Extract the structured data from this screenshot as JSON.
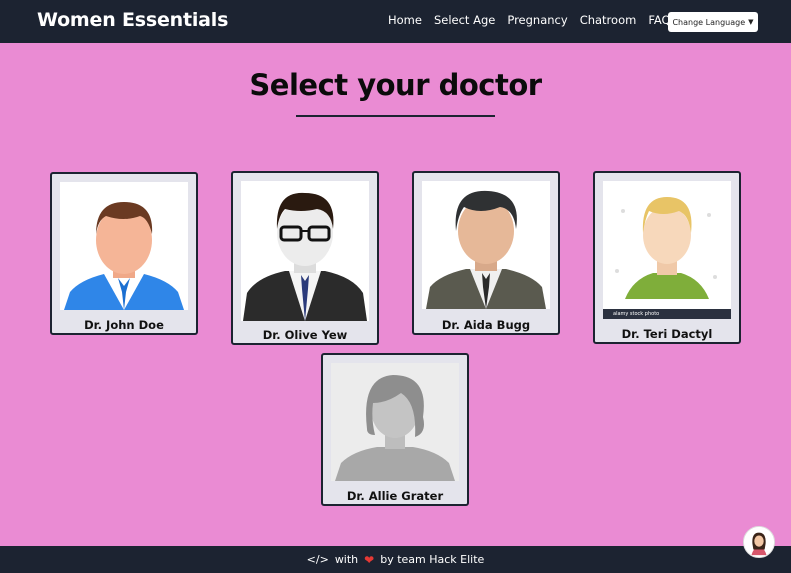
{
  "brand": "Women Essentials",
  "nav": {
    "links": [
      "Home",
      "Select Age",
      "Pregnancy",
      "Chatroom",
      "FAQ's"
    ],
    "language_button": "Change Language"
  },
  "page_title": "Select your doctor",
  "doctors": [
    {
      "name": "Dr. John Doe"
    },
    {
      "name": "Dr. Olive Yew"
    },
    {
      "name": "Dr. Aida Bugg"
    },
    {
      "name": "Dr. Teri Dactyl",
      "watermark": "alamy stock photo"
    },
    {
      "name": "Dr. Allie Grater"
    }
  ],
  "footer": {
    "code_symbol": "</>",
    "with": "with",
    "by": "by team Hack Elite"
  },
  "colors": {
    "background": "#ea8bd3",
    "navbar": "#1c2331",
    "card": "#e4e4ec",
    "heart": "#e53935"
  }
}
